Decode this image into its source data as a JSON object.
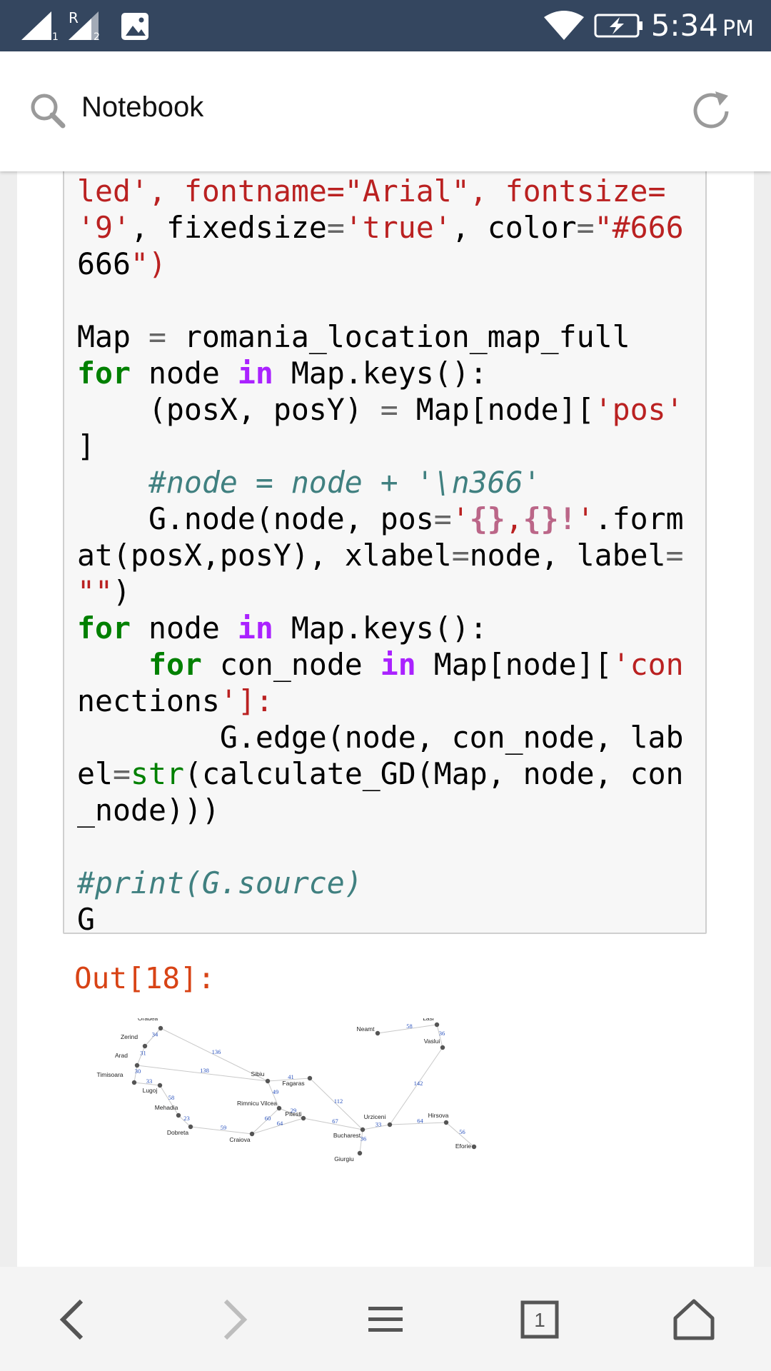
{
  "status_bar": {
    "time": "5:34",
    "ampm": "PM",
    "sim1_label": "1",
    "sim2_label": "2",
    "roaming_label": "R",
    "icons": [
      "signal-icon",
      "signal-roaming-icon",
      "gallery-notification-icon",
      "wifi-icon",
      "battery-charging-icon"
    ]
  },
  "address_bar": {
    "title": "Notebook",
    "icons": [
      "search-icon",
      "reload-icon"
    ]
  },
  "notebook": {
    "code_lines": [
      "led', fontname=\"Arial\", fontsize=",
      "'9', fixedsize='true', color=\"#666",
      "666\")",
      "",
      "Map = romania_location_map_full",
      "for node in Map.keys():",
      "    (posX, posY) = Map[node]['pos'",
      "]",
      "    #node = node + '\\n366'",
      "    G.node(node, pos='{},{}!'.form",
      "at(posX,posY), xlabel=node, label=",
      "\"\")",
      "for node in Map.keys():",
      "    for con_node in Map[node]['con",
      "nections']:",
      "        G.edge(node, con_node, lab",
      "el=str(calculate_GD(Map, node, con",
      "_node)))",
      "",
      "#print(G.source)",
      "G"
    ],
    "out_prompt": "Out[18]:",
    "graph": {
      "nodes": [
        "Oradea",
        "Zerind",
        "Arad",
        "Timisoara",
        "Lugoj",
        "Mehadia",
        "Dobreta",
        "Craiova",
        "Sibiu",
        "Fagaras",
        "Rimnicu Vilcea",
        "Pitesti",
        "Bucharest",
        "Giurgiu",
        "Urziceni",
        "Hirsova",
        "Eforie",
        "Vaslui",
        "Lasi",
        "Neamt"
      ],
      "edges": [
        {
          "from": "Oradea",
          "to": "Zerind",
          "label": "34"
        },
        {
          "from": "Zerind",
          "to": "Arad",
          "label": "31"
        },
        {
          "from": "Oradea",
          "to": "Sibiu",
          "label": "136"
        },
        {
          "from": "Arad",
          "to": "Sibiu",
          "label": "138"
        },
        {
          "from": "Arad",
          "to": "Timisoara",
          "label": "30"
        },
        {
          "from": "Timisoara",
          "to": "Lugoj",
          "label": "33"
        },
        {
          "from": "Lugoj",
          "to": "Mehadia",
          "label": "58"
        },
        {
          "from": "Mehadia",
          "to": "Dobreta",
          "label": "23"
        },
        {
          "from": "Dobreta",
          "to": "Craiova",
          "label": "59"
        },
        {
          "from": "Sibiu",
          "to": "Fagaras",
          "label": "41"
        },
        {
          "from": "Sibiu",
          "to": "Rimnicu Vilcea",
          "label": "49"
        },
        {
          "from": "Rimnicu Vilcea",
          "to": "Pitesti",
          "label": "29"
        },
        {
          "from": "Rimnicu Vilcea",
          "to": "Craiova",
          "label": "60"
        },
        {
          "from": "Craiova",
          "to": "Pitesti",
          "label": "64"
        },
        {
          "from": "Pitesti",
          "to": "Bucharest",
          "label": "67"
        },
        {
          "from": "Fagaras",
          "to": "Bucharest",
          "label": "112"
        },
        {
          "from": "Bucharest",
          "to": "Giurgiu",
          "label": "36"
        },
        {
          "from": "Bucharest",
          "to": "Urziceni",
          "label": "33"
        },
        {
          "from": "Urziceni",
          "to": "Hirsova",
          "label": "64"
        },
        {
          "from": "Hirsova",
          "to": "Eforie",
          "label": "56"
        },
        {
          "from": "Urziceni",
          "to": "Vaslui",
          "label": "142"
        },
        {
          "from": "Vaslui",
          "to": "Lasi",
          "label": "36"
        },
        {
          "from": "Lasi",
          "to": "Neamt",
          "label": "58"
        }
      ]
    }
  },
  "toolbar": {
    "tab_count": "1",
    "icons": [
      "back-icon",
      "forward-icon",
      "menu-icon",
      "tabs-icon",
      "home-icon"
    ]
  },
  "colors": {
    "status_bar": "#34465f",
    "keyword": "#008000",
    "operator_word": "#aa22ff",
    "string": "#ba2121",
    "comment": "#408080",
    "out_prompt": "#d84315",
    "edge_label": "#2a52be"
  }
}
